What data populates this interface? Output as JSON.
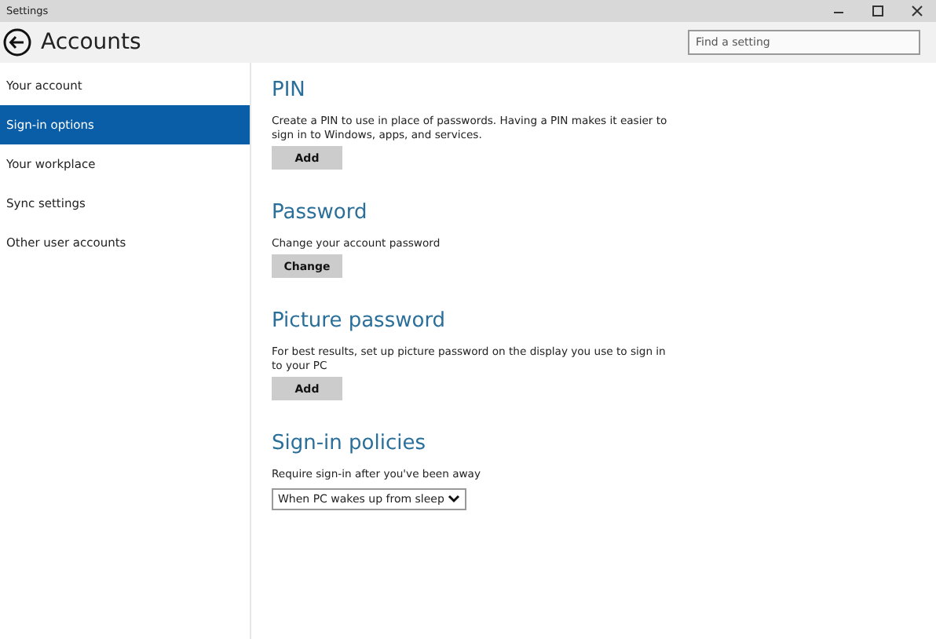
{
  "window": {
    "title": "Settings"
  },
  "header": {
    "title": "Accounts",
    "search": {
      "placeholder": "Find a setting"
    }
  },
  "sidebar": {
    "items": [
      {
        "label": "Your account",
        "selected": false
      },
      {
        "label": "Sign-in options",
        "selected": true
      },
      {
        "label": "Your workplace",
        "selected": false
      },
      {
        "label": "Sync settings",
        "selected": false
      },
      {
        "label": "Other user accounts",
        "selected": false
      }
    ]
  },
  "sections": [
    {
      "title": "PIN",
      "kind": "button",
      "description": "Create a PIN to use in place of passwords. Having a PIN makes it easier to sign in to Windows, apps, and services.",
      "button": "Add"
    },
    {
      "title": "Password",
      "kind": "button",
      "description": "Change your account password",
      "button": "Change"
    },
    {
      "title": "Picture password",
      "kind": "button",
      "description": "For best results, set up picture password on the display you use to sign in to your PC",
      "button": "Add"
    },
    {
      "title": "Sign-in policies",
      "kind": "dropdown",
      "description": "Require sign-in after you've been away",
      "value": "When PC wakes up from sleep"
    }
  ]
}
